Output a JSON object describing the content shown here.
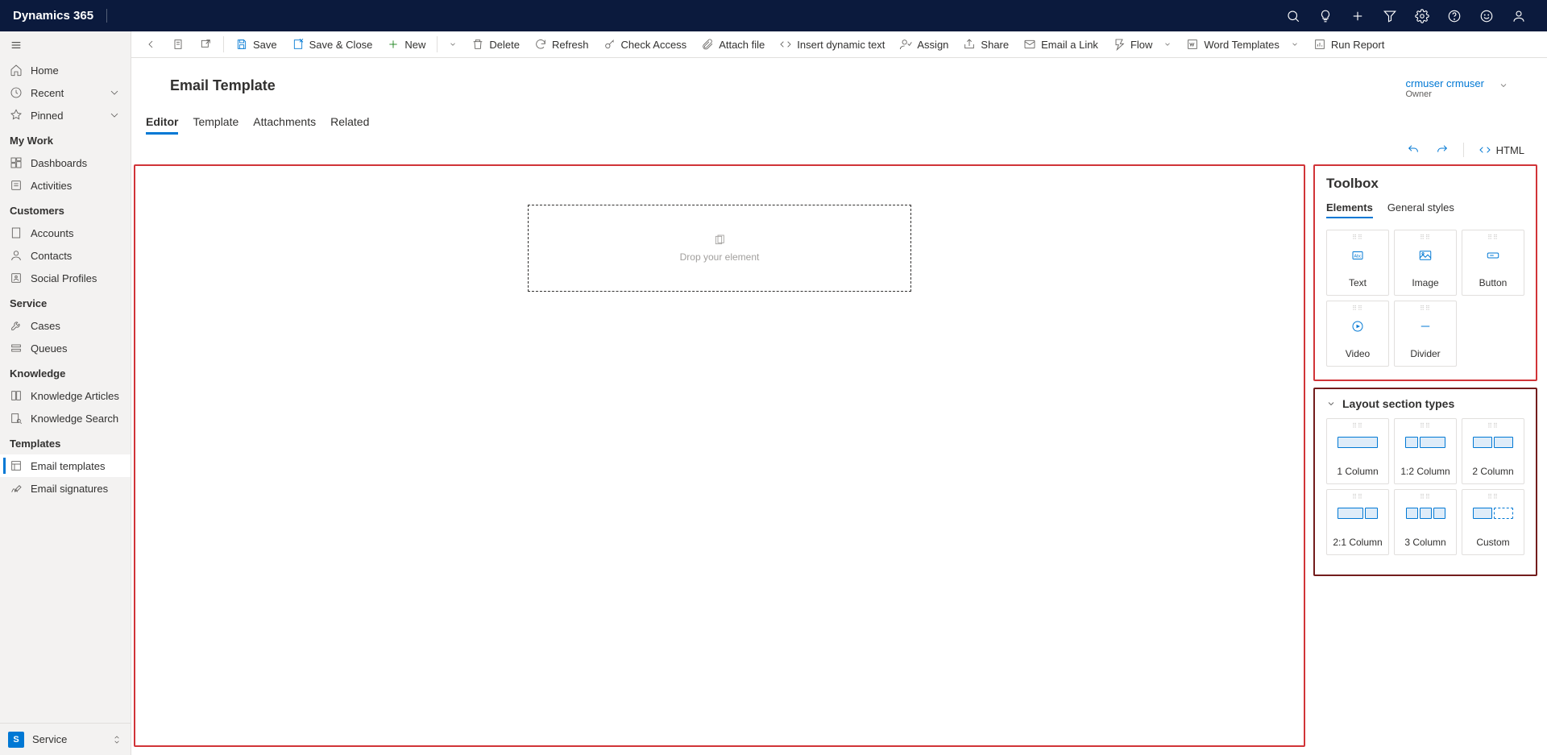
{
  "header": {
    "brand": "Dynamics 365"
  },
  "sidebar": {
    "home": "Home",
    "recent": "Recent",
    "pinned": "Pinned",
    "sections": {
      "mywork": "My Work",
      "customers": "Customers",
      "service": "Service",
      "knowledge": "Knowledge",
      "templates": "Templates"
    },
    "items": {
      "dashboards": "Dashboards",
      "activities": "Activities",
      "accounts": "Accounts",
      "contacts": "Contacts",
      "socialprofiles": "Social Profiles",
      "cases": "Cases",
      "queues": "Queues",
      "knowledgearticles": "Knowledge Articles",
      "knowledgesearch": "Knowledge Search",
      "emailtemplates": "Email templates",
      "emailsignatures": "Email signatures"
    },
    "footer": {
      "badge": "S",
      "label": "Service"
    }
  },
  "toolbar": {
    "save": "Save",
    "saveclose": "Save & Close",
    "new": "New",
    "delete": "Delete",
    "refresh": "Refresh",
    "checkaccess": "Check Access",
    "attachfile": "Attach file",
    "insertdynamic": "Insert dynamic text",
    "assign": "Assign",
    "share": "Share",
    "emailalink": "Email a Link",
    "flow": "Flow",
    "wordtemplates": "Word Templates",
    "runreport": "Run Report"
  },
  "page": {
    "title": "Email Template",
    "owner_name": "crmuser crmuser",
    "owner_label": "Owner"
  },
  "tabs": {
    "editor": "Editor",
    "template": "Template",
    "attachments": "Attachments",
    "related": "Related"
  },
  "subtoolbar": {
    "html": "HTML"
  },
  "canvas": {
    "drop_text": "Drop your element"
  },
  "toolbox": {
    "title": "Toolbox",
    "tab_elements": "Elements",
    "tab_styles": "General styles",
    "elements": {
      "text": "Text",
      "image": "Image",
      "button": "Button",
      "video": "Video",
      "divider": "Divider"
    },
    "layout_title": "Layout section types",
    "layouts": {
      "col1": "1 Column",
      "col12": "1:2 Column",
      "col2": "2 Column",
      "col21": "2:1 Column",
      "col3": "3 Column",
      "custom": "Custom"
    }
  }
}
